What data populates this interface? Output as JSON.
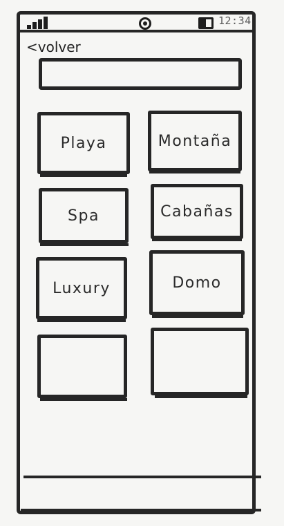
{
  "status_bar": {
    "time": "12:34",
    "signal_icon": "signal-bars-icon",
    "camera_icon": "camera-icon",
    "battery_icon": "battery-icon"
  },
  "header": {
    "back_label": "<volver"
  },
  "search": {
    "value": "",
    "placeholder": ""
  },
  "categories": {
    "items": [
      {
        "label": "Playa"
      },
      {
        "label": "Montaña"
      },
      {
        "label": "Spa"
      },
      {
        "label": "Cabañas"
      },
      {
        "label": "Luxury"
      },
      {
        "label": "Domo"
      },
      {
        "label": ""
      },
      {
        "label": ""
      }
    ]
  }
}
